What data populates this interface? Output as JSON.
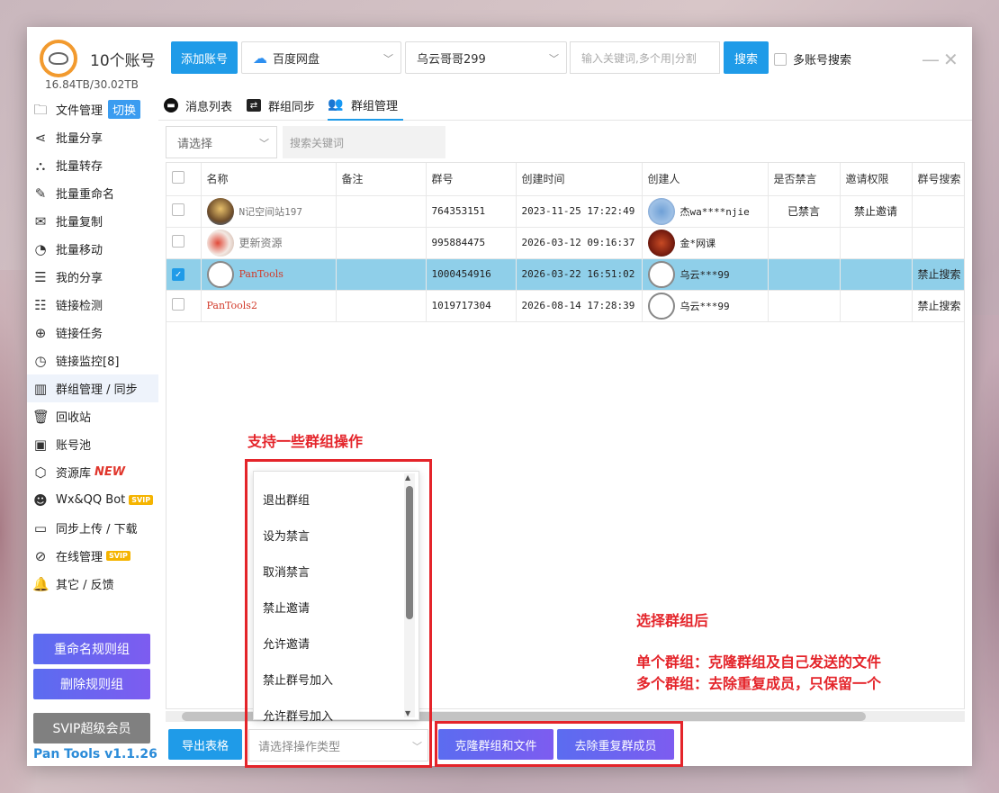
{
  "account": {
    "count_label": "10个账号",
    "storage": "16.84TB/30.02TB"
  },
  "sidebar": {
    "items": [
      {
        "label": "文件管理",
        "icon": "folder-icon",
        "badge": "切换"
      },
      {
        "label": "批量分享",
        "icon": "share-icon"
      },
      {
        "label": "批量转存",
        "icon": "transfer-icon"
      },
      {
        "label": "批量重命名",
        "icon": "rename-icon"
      },
      {
        "label": "批量复制",
        "icon": "copy-icon"
      },
      {
        "label": "批量移动",
        "icon": "move-icon"
      },
      {
        "label": "我的分享",
        "icon": "my-share-icon"
      },
      {
        "label": "链接检测",
        "icon": "link-check-icon"
      },
      {
        "label": "链接任务",
        "icon": "link-task-icon"
      },
      {
        "label": "链接监控[8]",
        "icon": "link-monitor-icon"
      },
      {
        "label": "群组管理 / 同步",
        "icon": "group-icon"
      },
      {
        "label": "回收站",
        "icon": "trash-icon"
      },
      {
        "label": "账号池",
        "icon": "account-pool-icon"
      },
      {
        "label": "资源库",
        "icon": "resource-icon",
        "tag": "NEW"
      },
      {
        "label": "Wx&QQ Bot",
        "icon": "bot-icon",
        "tag": "SVIP"
      },
      {
        "label": "同步上传 / 下载",
        "icon": "sync-icon"
      },
      {
        "label": "在线管理",
        "icon": "online-icon",
        "tag": "SVIP"
      },
      {
        "label": "其它 / 反馈",
        "icon": "bell-icon"
      }
    ],
    "rename_rule_btn": "重命名规则组",
    "delete_rule_btn": "删除规则组",
    "svip_btn": "SVIP超级会员",
    "version": "Pan Tools v1.1.26"
  },
  "topbar": {
    "add_account": "添加账号",
    "cloud": "百度网盘",
    "user": "乌云哥哥299",
    "search_placeholder": "输入关键词,多个用|分割",
    "search_btn": "搜索",
    "multi_search": "多账号搜索"
  },
  "tabs": [
    {
      "label": "消息列表"
    },
    {
      "label": "群组同步"
    },
    {
      "label": "群组管理"
    }
  ],
  "filter": {
    "select": "请选择",
    "search_placeholder": "搜索关键词"
  },
  "table": {
    "headers": [
      "名称",
      "备注",
      "群号",
      "创建时间",
      "创建人",
      "是否禁言",
      "邀请权限",
      "群号搜索"
    ],
    "rows": [
      {
        "name": "N记空间站197",
        "note": "",
        "id": "764353151",
        "time": "2023-11-25 17:22:49",
        "creator": "杰wa****njie",
        "mute": "已禁言",
        "invite": "禁止邀请",
        "search": ""
      },
      {
        "name": "更新资源",
        "note": "",
        "id": "995884475",
        "time": "2026-03-12 09:16:37",
        "creator": "金*网课",
        "mute": "",
        "invite": "",
        "search": ""
      },
      {
        "name": "PanTools",
        "note": "",
        "id": "1000454916",
        "time": "2026-03-22 16:51:02",
        "creator": "乌云***99",
        "mute": "",
        "invite": "",
        "search": "禁止搜索"
      },
      {
        "name": "PanTools2",
        "note": "",
        "id": "1019717304",
        "time": "2026-08-14 17:28:39",
        "creator": "乌云***99",
        "mute": "",
        "invite": "",
        "search": "禁止搜索"
      }
    ]
  },
  "dropdown": {
    "options": [
      "退出群组",
      "设为禁言",
      "取消禁言",
      "禁止邀请",
      "允许邀请",
      "禁止群号加入",
      "允许群号加入"
    ]
  },
  "bottom": {
    "export": "导出表格",
    "op_placeholder": "请选择操作类型",
    "clone_btn": "克隆群组和文件",
    "dedupe_btn": "去除重复群成员"
  },
  "annotations": {
    "ops_title": "支持一些群组操作",
    "after_select": "选择群组后",
    "single": "单个群组：克隆群组及自己发送的文件",
    "multi": "多个群组：去除重复成员，只保留一个"
  },
  "colors": {
    "accent": "#1f9be8",
    "selected_row": "#8fcfe9",
    "annotation": "#e4242a"
  }
}
